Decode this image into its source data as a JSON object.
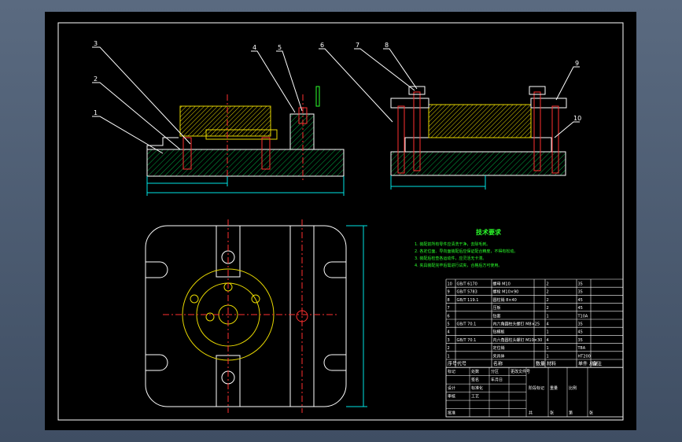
{
  "callouts": [
    "1",
    "2",
    "3",
    "4",
    "5",
    "6",
    "7",
    "8",
    "9",
    "10"
  ],
  "notes": {
    "title": "技术要求",
    "lines": [
      "1. 装配前所有零件应清洗干净，去除毛刺。",
      "2. 各定位面、导向面装配后应保证配合精度，不得有松动。",
      "3. 装配后检查各运动件，应灵活无卡滞。",
      "4. 夹具装配完毕后需进行试夹，合格后方可使用。"
    ]
  },
  "bom": {
    "rows": [
      [
        "10",
        "GB/T 6170",
        "螺母 M10",
        "",
        "2",
        "35"
      ],
      [
        "9",
        "GB/T 5783",
        "螺栓 M10×90",
        "",
        "2",
        "35"
      ],
      [
        "8",
        "GB/T 119.1",
        "圆柱销 8×40",
        "",
        "2",
        "45"
      ],
      [
        "7",
        "",
        "压板",
        "",
        "2",
        "45"
      ],
      [
        "6",
        "",
        "钻套",
        "",
        "1",
        "T10A"
      ],
      [
        "5",
        "GB/T 70.1",
        "内六角圆柱头螺钉 M8×25",
        "",
        "4",
        "35"
      ],
      [
        "4",
        "",
        "钻模板",
        "",
        "1",
        "45"
      ],
      [
        "3",
        "GB/T 70.1",
        "内六角圆柱头螺钉 M10×30",
        "",
        "4",
        "35"
      ],
      [
        "2",
        "",
        "定位销",
        "",
        "1",
        "T8A"
      ],
      [
        "1",
        "",
        "夹具体",
        "",
        "1",
        "HT200"
      ]
    ],
    "headers": [
      "序号",
      "代号",
      "名称",
      "数量",
      "材料",
      "单件 总计",
      "备注"
    ],
    "title_labels": [
      "标记",
      "处数",
      "分区",
      "更改文件号",
      "签名",
      "年月日",
      "设计",
      "标准化",
      "审核",
      "工艺",
      "批准",
      "阶段标记",
      "重量",
      "比例",
      "共",
      "张",
      "第",
      "张"
    ]
  },
  "colors": {
    "outline": "#ffffff",
    "hatch": "#00aa44",
    "part_yellow": "#e8d800",
    "part_red": "#ff3030",
    "dim_cyan": "#00e5e5",
    "annotation_green": "#2bff2b"
  }
}
